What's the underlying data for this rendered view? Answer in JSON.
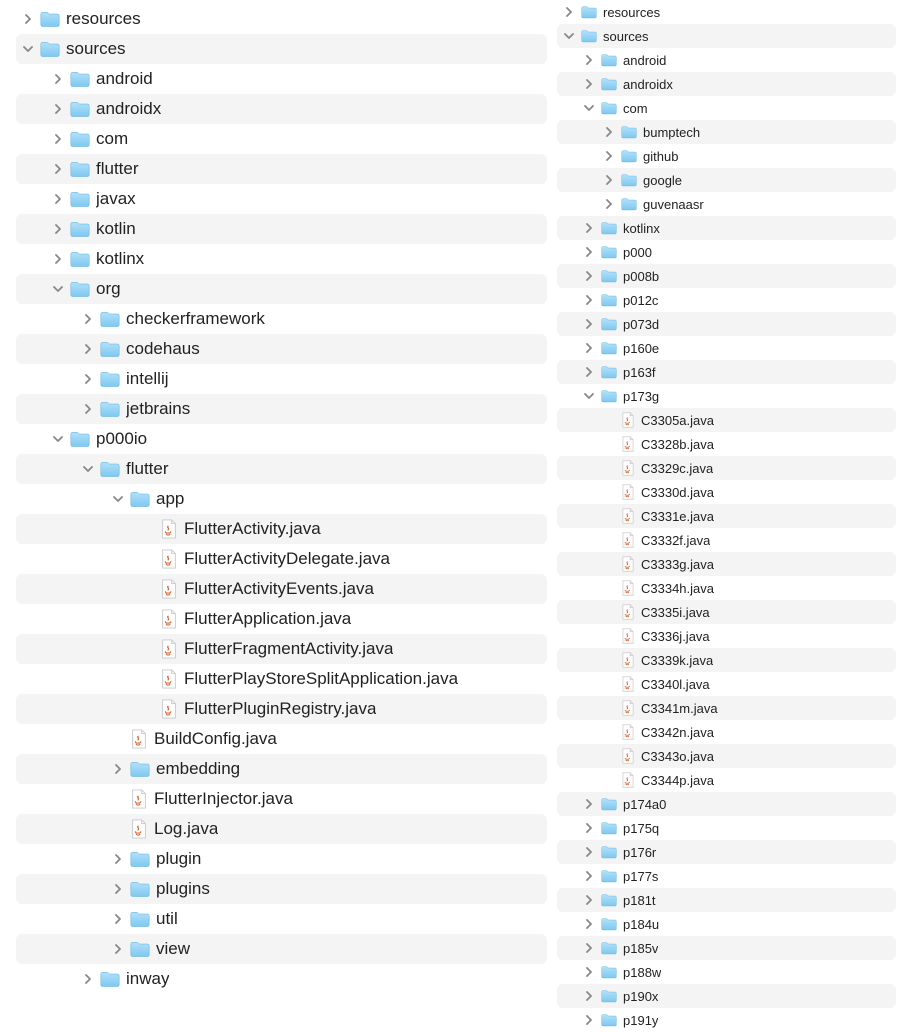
{
  "left": {
    "rows": [
      {
        "depth": 0,
        "type": "folder",
        "state": "closed",
        "label": "resources",
        "alt": false
      },
      {
        "depth": 0,
        "type": "folder",
        "state": "open",
        "label": "sources",
        "alt": true
      },
      {
        "depth": 1,
        "type": "folder",
        "state": "closed",
        "label": "android",
        "alt": false
      },
      {
        "depth": 1,
        "type": "folder",
        "state": "closed",
        "label": "androidx",
        "alt": true
      },
      {
        "depth": 1,
        "type": "folder",
        "state": "closed",
        "label": "com",
        "alt": false
      },
      {
        "depth": 1,
        "type": "folder",
        "state": "closed",
        "label": "flutter",
        "alt": true
      },
      {
        "depth": 1,
        "type": "folder",
        "state": "closed",
        "label": "javax",
        "alt": false
      },
      {
        "depth": 1,
        "type": "folder",
        "state": "closed",
        "label": "kotlin",
        "alt": true
      },
      {
        "depth": 1,
        "type": "folder",
        "state": "closed",
        "label": "kotlinx",
        "alt": false
      },
      {
        "depth": 1,
        "type": "folder",
        "state": "open",
        "label": "org",
        "alt": true
      },
      {
        "depth": 2,
        "type": "folder",
        "state": "closed",
        "label": "checkerframework",
        "alt": false
      },
      {
        "depth": 2,
        "type": "folder",
        "state": "closed",
        "label": "codehaus",
        "alt": true
      },
      {
        "depth": 2,
        "type": "folder",
        "state": "closed",
        "label": "intellij",
        "alt": false
      },
      {
        "depth": 2,
        "type": "folder",
        "state": "closed",
        "label": "jetbrains",
        "alt": true
      },
      {
        "depth": 1,
        "type": "folder",
        "state": "open",
        "label": "p000io",
        "alt": false
      },
      {
        "depth": 2,
        "type": "folder",
        "state": "open",
        "label": "flutter",
        "alt": true
      },
      {
        "depth": 3,
        "type": "folder",
        "state": "open",
        "label": "app",
        "alt": false
      },
      {
        "depth": 4,
        "type": "java",
        "label": "FlutterActivity.java",
        "alt": true
      },
      {
        "depth": 4,
        "type": "java",
        "label": "FlutterActivityDelegate.java",
        "alt": false
      },
      {
        "depth": 4,
        "type": "java",
        "label": "FlutterActivityEvents.java",
        "alt": true
      },
      {
        "depth": 4,
        "type": "java",
        "label": "FlutterApplication.java",
        "alt": false
      },
      {
        "depth": 4,
        "type": "java",
        "label": "FlutterFragmentActivity.java",
        "alt": true
      },
      {
        "depth": 4,
        "type": "java",
        "label": "FlutterPlayStoreSplitApplication.java",
        "alt": false
      },
      {
        "depth": 4,
        "type": "java",
        "label": "FlutterPluginRegistry.java",
        "alt": true
      },
      {
        "depth": 3,
        "type": "java",
        "label": "BuildConfig.java",
        "alt": false
      },
      {
        "depth": 3,
        "type": "folder",
        "state": "closed",
        "label": "embedding",
        "alt": true
      },
      {
        "depth": 3,
        "type": "java",
        "label": "FlutterInjector.java",
        "alt": false
      },
      {
        "depth": 3,
        "type": "java",
        "label": "Log.java",
        "alt": true
      },
      {
        "depth": 3,
        "type": "folder",
        "state": "closed",
        "label": "plugin",
        "alt": false
      },
      {
        "depth": 3,
        "type": "folder",
        "state": "closed",
        "label": "plugins",
        "alt": true
      },
      {
        "depth": 3,
        "type": "folder",
        "state": "closed",
        "label": "util",
        "alt": false
      },
      {
        "depth": 3,
        "type": "folder",
        "state": "closed",
        "label": "view",
        "alt": true
      },
      {
        "depth": 2,
        "type": "folder",
        "state": "closed",
        "label": "inway",
        "alt": false
      }
    ]
  },
  "right": {
    "rows": [
      {
        "depth": 0,
        "type": "folder",
        "state": "closed",
        "label": "resources",
        "alt": false
      },
      {
        "depth": 0,
        "type": "folder",
        "state": "open",
        "label": "sources",
        "alt": true
      },
      {
        "depth": 1,
        "type": "folder",
        "state": "closed",
        "label": "android",
        "alt": false
      },
      {
        "depth": 1,
        "type": "folder",
        "state": "closed",
        "label": "androidx",
        "alt": true
      },
      {
        "depth": 1,
        "type": "folder",
        "state": "open",
        "label": "com",
        "alt": false
      },
      {
        "depth": 2,
        "type": "folder",
        "state": "closed",
        "label": "bumptech",
        "alt": true
      },
      {
        "depth": 2,
        "type": "folder",
        "state": "closed",
        "label": "github",
        "alt": false
      },
      {
        "depth": 2,
        "type": "folder",
        "state": "closed",
        "label": "google",
        "alt": true
      },
      {
        "depth": 2,
        "type": "folder",
        "state": "closed",
        "label": "guvenaasr",
        "alt": false
      },
      {
        "depth": 1,
        "type": "folder",
        "state": "closed",
        "label": "kotlinx",
        "alt": true
      },
      {
        "depth": 1,
        "type": "folder",
        "state": "closed",
        "label": "p000",
        "alt": false
      },
      {
        "depth": 1,
        "type": "folder",
        "state": "closed",
        "label": "p008b",
        "alt": true
      },
      {
        "depth": 1,
        "type": "folder",
        "state": "closed",
        "label": "p012c",
        "alt": false
      },
      {
        "depth": 1,
        "type": "folder",
        "state": "closed",
        "label": "p073d",
        "alt": true
      },
      {
        "depth": 1,
        "type": "folder",
        "state": "closed",
        "label": "p160e",
        "alt": false
      },
      {
        "depth": 1,
        "type": "folder",
        "state": "closed",
        "label": "p163f",
        "alt": true
      },
      {
        "depth": 1,
        "type": "folder",
        "state": "open",
        "label": "p173g",
        "alt": false
      },
      {
        "depth": 2,
        "type": "java",
        "label": "C3305a.java",
        "alt": true
      },
      {
        "depth": 2,
        "type": "java",
        "label": "C3328b.java",
        "alt": false
      },
      {
        "depth": 2,
        "type": "java",
        "label": "C3329c.java",
        "alt": true
      },
      {
        "depth": 2,
        "type": "java",
        "label": "C3330d.java",
        "alt": false
      },
      {
        "depth": 2,
        "type": "java",
        "label": "C3331e.java",
        "alt": true
      },
      {
        "depth": 2,
        "type": "java",
        "label": "C3332f.java",
        "alt": false
      },
      {
        "depth": 2,
        "type": "java",
        "label": "C3333g.java",
        "alt": true
      },
      {
        "depth": 2,
        "type": "java",
        "label": "C3334h.java",
        "alt": false
      },
      {
        "depth": 2,
        "type": "java",
        "label": "C3335i.java",
        "alt": true
      },
      {
        "depth": 2,
        "type": "java",
        "label": "C3336j.java",
        "alt": false
      },
      {
        "depth": 2,
        "type": "java",
        "label": "C3339k.java",
        "alt": true
      },
      {
        "depth": 2,
        "type": "java",
        "label": "C3340l.java",
        "alt": false
      },
      {
        "depth": 2,
        "type": "java",
        "label": "C3341m.java",
        "alt": true
      },
      {
        "depth": 2,
        "type": "java",
        "label": "C3342n.java",
        "alt": false
      },
      {
        "depth": 2,
        "type": "java",
        "label": "C3343o.java",
        "alt": true
      },
      {
        "depth": 2,
        "type": "java",
        "label": "C3344p.java",
        "alt": false
      },
      {
        "depth": 1,
        "type": "folder",
        "state": "closed",
        "label": "p174a0",
        "alt": true
      },
      {
        "depth": 1,
        "type": "folder",
        "state": "closed",
        "label": "p175q",
        "alt": false
      },
      {
        "depth": 1,
        "type": "folder",
        "state": "closed",
        "label": "p176r",
        "alt": true
      },
      {
        "depth": 1,
        "type": "folder",
        "state": "closed",
        "label": "p177s",
        "alt": false
      },
      {
        "depth": 1,
        "type": "folder",
        "state": "closed",
        "label": "p181t",
        "alt": true
      },
      {
        "depth": 1,
        "type": "folder",
        "state": "closed",
        "label": "p184u",
        "alt": false
      },
      {
        "depth": 1,
        "type": "folder",
        "state": "closed",
        "label": "p185v",
        "alt": true
      },
      {
        "depth": 1,
        "type": "folder",
        "state": "closed",
        "label": "p188w",
        "alt": false
      },
      {
        "depth": 1,
        "type": "folder",
        "state": "closed",
        "label": "p190x",
        "alt": true
      },
      {
        "depth": 1,
        "type": "folder",
        "state": "closed",
        "label": "p191y",
        "alt": false
      }
    ]
  }
}
